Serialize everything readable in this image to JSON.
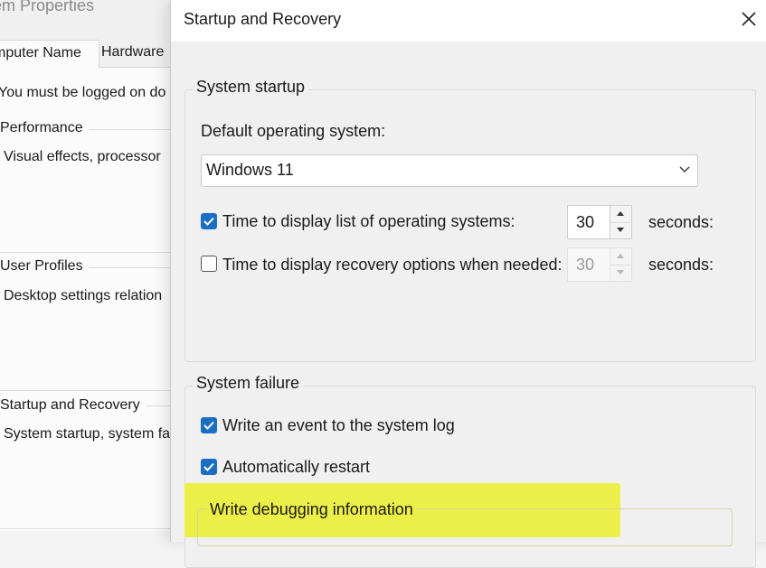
{
  "background_window": {
    "title": "em Properties",
    "tabs": [
      "mputer Name",
      "Hardware"
    ],
    "notice": "You must be logged on do",
    "sections": [
      {
        "title": "Performance",
        "desc": "Visual effects, processor"
      },
      {
        "title": "User Profiles",
        "desc": "Desktop settings relation"
      },
      {
        "title": "Startup and Recovery",
        "desc": "System startup, system fa"
      }
    ]
  },
  "dialog": {
    "title": "Startup and Recovery",
    "close_icon": "close-icon",
    "system_startup": {
      "legend": "System startup",
      "default_os_label": "Default operating system:",
      "default_os_value": "Windows 11",
      "display_os_list": {
        "label": "Time to display list of operating systems:",
        "checked": true,
        "value": "30",
        "unit": "seconds:"
      },
      "display_recovery": {
        "label": "Time to display recovery options when needed:",
        "checked": false,
        "value": "30",
        "unit": "seconds:"
      }
    },
    "system_failure": {
      "legend": "System failure",
      "write_event": {
        "label": "Write an event to the system log",
        "checked": true
      },
      "auto_restart": {
        "label": "Automatically restart",
        "checked": true
      },
      "debugging_legend": "Write debugging information"
    }
  },
  "colors": {
    "accent": "#1a6fc4",
    "highlight": "#ecef48",
    "dialog_bg": "#f0f0f0"
  }
}
